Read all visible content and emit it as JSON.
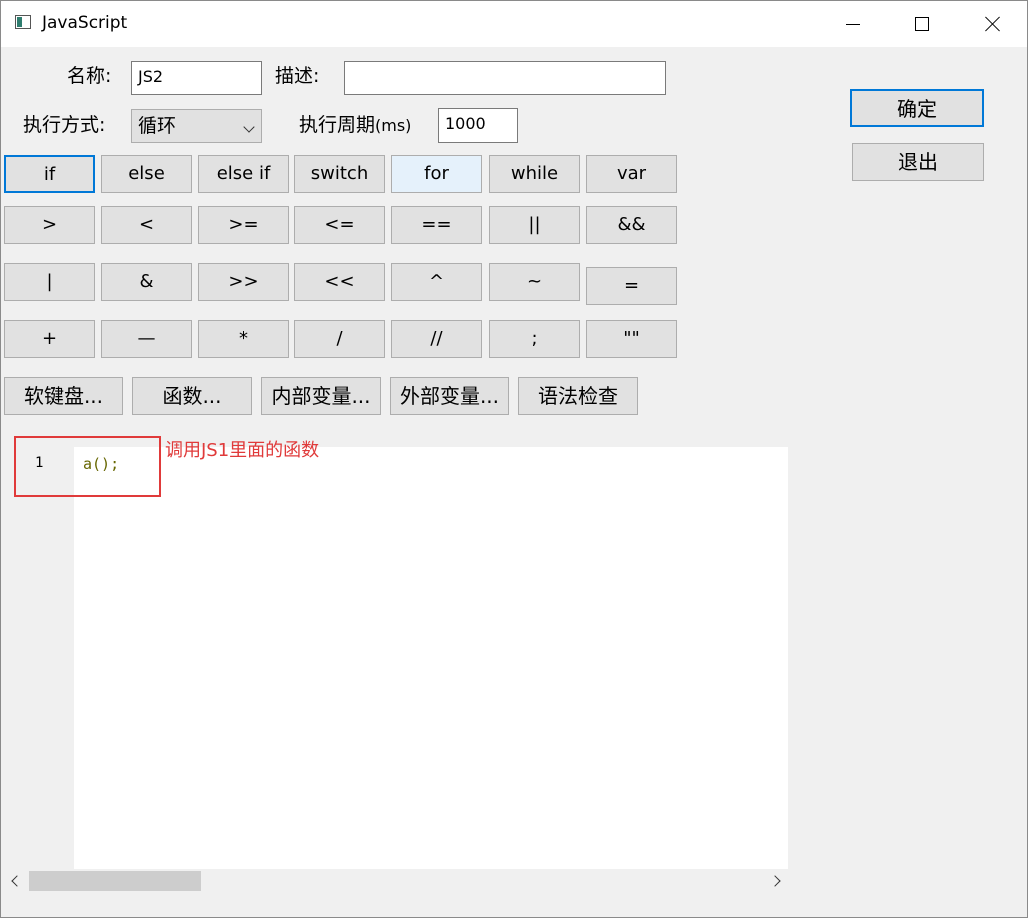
{
  "window": {
    "title": "JavaScript",
    "icon": "window-app-icon",
    "controls": [
      "minimize-icon",
      "maximize-icon",
      "close-icon"
    ]
  },
  "form": {
    "name_label": "名称:",
    "name_value": "JS2",
    "desc_label": "描述:",
    "desc_value": "",
    "mode_label": "执行方式:",
    "mode_value": "循环",
    "period_label": "执行周期",
    "period_unit": "(ms)",
    "period_value": "1000"
  },
  "actions": {
    "confirm": "确定",
    "exit": "退出"
  },
  "keyword_buttons": [
    "if",
    "else",
    "else if",
    "switch",
    "for",
    "while",
    "var"
  ],
  "operator_rows": [
    [
      ">",
      "<",
      ">=",
      "<=",
      "==",
      "||",
      "&&"
    ],
    [
      "|",
      "&",
      ">>",
      "<<",
      "^",
      "~",
      "="
    ],
    [
      "+",
      "—",
      "*",
      "/",
      "//",
      ";",
      "\"\""
    ]
  ],
  "tool_buttons": [
    "软键盘...",
    "函数...",
    "内部变量...",
    "外部变量...",
    "语法检查"
  ],
  "editor": {
    "line_number": "1",
    "code": "a();",
    "annotation": "调用JS1里面的函数"
  },
  "colors": {
    "focus_border": "#0078d7",
    "annotation": "#e03a3a",
    "code_text": "#666600"
  }
}
